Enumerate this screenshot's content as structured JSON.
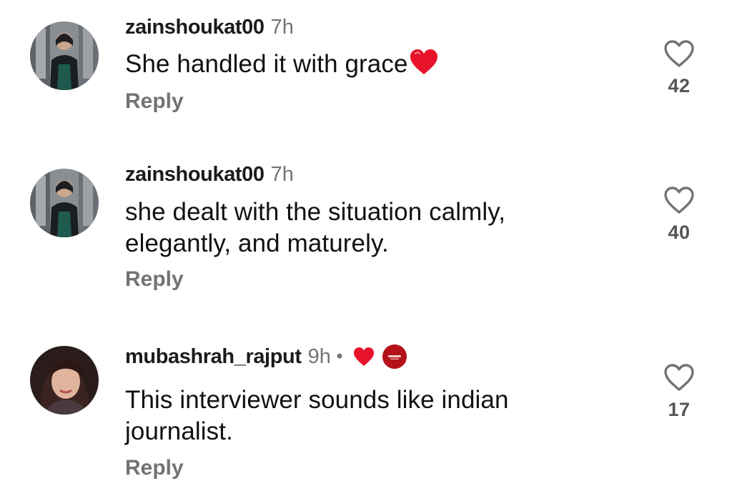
{
  "comments": [
    {
      "username": "zainshoukat00",
      "time": "7h",
      "text": "She handled it with grace",
      "reply_label": "Reply",
      "likes": "42",
      "avatar_icon": "profile-photo",
      "emoji": "red-heart"
    },
    {
      "username": "zainshoukat00",
      "time": "7h",
      "text_lines": [
        "she dealt with the situation calmly,",
        "elegantly, and maturely."
      ],
      "reply_label": "Reply",
      "likes": "40",
      "avatar_icon": "profile-photo"
    },
    {
      "username": "mubashrah_rajput",
      "time": "9h",
      "separator": "•",
      "badges": [
        "creator-liked-heart-icon",
        "creator-avatar-badge"
      ],
      "text_lines": [
        "This interviewer sounds like indian",
        "journalist."
      ],
      "reply_label": "Reply",
      "likes": "17",
      "avatar_icon": "profile-photo"
    }
  ],
  "colors": {
    "text": "#111111",
    "muted": "#737373",
    "heart_red": "#e8132b",
    "badge_red": "#b41218"
  }
}
